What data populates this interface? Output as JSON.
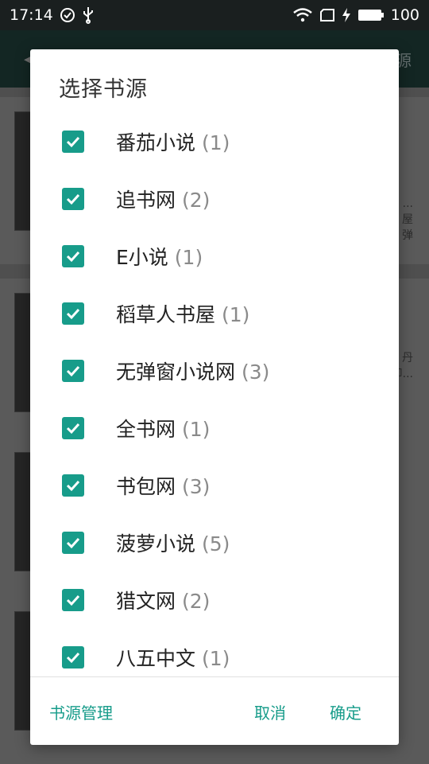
{
  "status_bar": {
    "time": "17:14",
    "battery": "100"
  },
  "app_bar": {
    "title_fragment": "源"
  },
  "background": {
    "snippets": [
      [
        "...",
        "屋",
        "弹"
      ],
      [
        "丹",
        "印..."
      ]
    ]
  },
  "dialog": {
    "title": "选择书源",
    "sources": [
      {
        "name": "番茄小说",
        "count": "(1)",
        "checked": true
      },
      {
        "name": "追书网",
        "count": "(2)",
        "checked": true
      },
      {
        "name": "E小说",
        "count": "(1)",
        "checked": true
      },
      {
        "name": "稻草人书屋",
        "count": "(1)",
        "checked": true
      },
      {
        "name": "无弹窗小说网",
        "count": "(3)",
        "checked": true
      },
      {
        "name": "全书网",
        "count": "(1)",
        "checked": true
      },
      {
        "name": "书包网",
        "count": "(3)",
        "checked": true
      },
      {
        "name": "菠萝小说",
        "count": "(5)",
        "checked": true
      },
      {
        "name": "猎文网",
        "count": "(2)",
        "checked": true
      },
      {
        "name": "八五中文",
        "count": "(1)",
        "checked": true
      }
    ],
    "actions": {
      "manage": "书源管理",
      "cancel": "取消",
      "ok": "确定"
    }
  },
  "colors": {
    "accent": "#179c8a",
    "status_bar": "#1a1f1f",
    "app_bar": "#1e3b37"
  }
}
